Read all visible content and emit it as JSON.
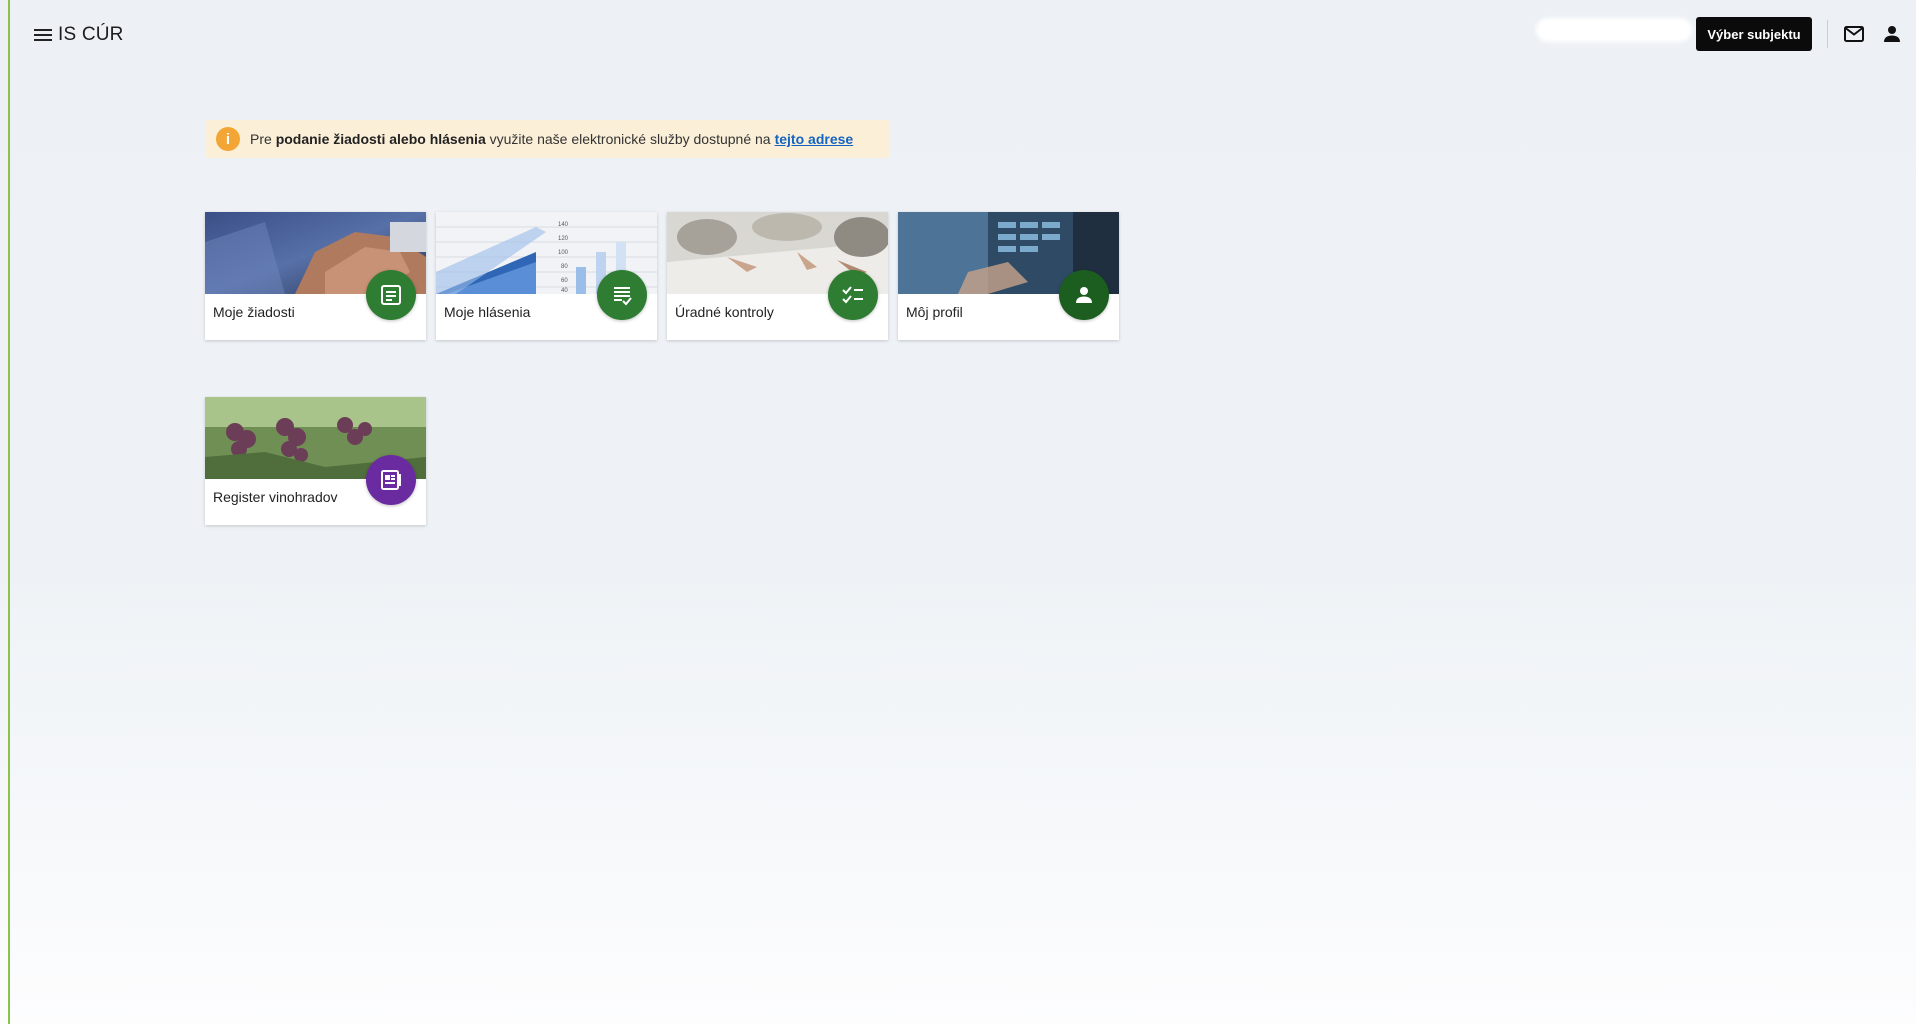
{
  "header": {
    "app_title": "IS CÚR",
    "subject_button_label": "Výber subjektu",
    "menu_icon": "menu-icon",
    "mail_icon": "mail-icon",
    "user_icon": "account-icon"
  },
  "notice": {
    "prefix": "Pre",
    "bold_text": "podanie žiadosti alebo hlásenia",
    "middle": "využite naše elektronické služby dostupné na",
    "link_text": "tejto adrese"
  },
  "tiles": [
    {
      "label": "Moje žiadosti",
      "icon": "document-icon",
      "badge_color": "#2e7d32"
    },
    {
      "label": "Moje hlásenia",
      "icon": "report-list-icon",
      "badge_color": "#2e7d32"
    },
    {
      "label": "Úradné kontroly",
      "icon": "checklist-icon",
      "badge_color": "#2e7d32"
    },
    {
      "label": "Môj profil",
      "icon": "person-icon",
      "badge_color": "#1b5e20"
    },
    {
      "label": "Register vinohradov",
      "icon": "register-icon",
      "badge_color": "#6a2ba0"
    }
  ],
  "colors": {
    "accent_green": "#2e7d32",
    "accent_purple": "#6a2ba0",
    "info_orange": "#f3a535",
    "notice_bg": "#fbefd8",
    "link_blue": "#1565c0",
    "left_border": "#8bc34a"
  }
}
